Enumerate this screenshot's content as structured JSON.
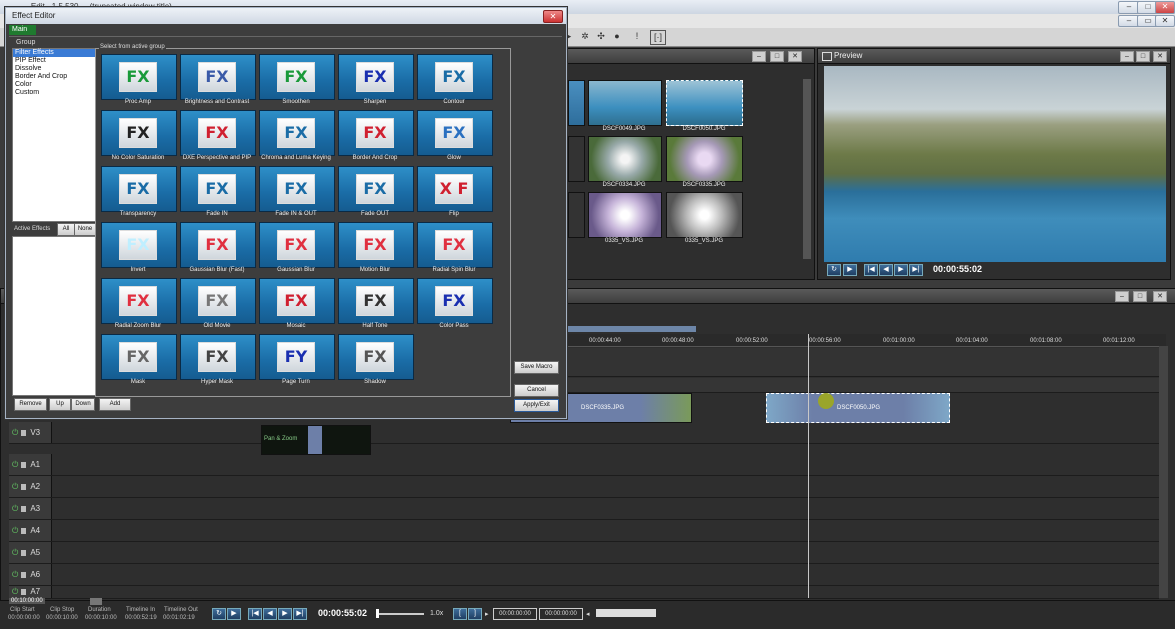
{
  "app": {
    "title": "... Edit - 1.5.530 ... (truncated window title)"
  },
  "effect_editor": {
    "title": "Effect Editor",
    "tab": "Main",
    "group_label": "Group",
    "groups": [
      "Filter Effects",
      "PIP Effect",
      "Dissolve",
      "Border And Crop",
      "Color",
      "Custom"
    ],
    "select_label": "Select from active group",
    "active_effects_label": "Active Effects",
    "all_label": "All",
    "none_label": "None",
    "effects": [
      {
        "label": "Proc Amp",
        "logo": "FX",
        "color": "#1a9a3a"
      },
      {
        "label": "Brightness and Contrast",
        "logo": "FX",
        "color": "#3a5aa8"
      },
      {
        "label": "Smoothen",
        "logo": "FX",
        "color": "#1a9a3a"
      },
      {
        "label": "Sharpen",
        "logo": "FX",
        "color": "#1a2fb0"
      },
      {
        "label": "Contour",
        "logo": "FX",
        "color": "#1a6ca6"
      },
      {
        "label": "No Color Saturation",
        "logo": "FX",
        "color": "#222222"
      },
      {
        "label": "DXE Perspective and PIP",
        "logo": "FX",
        "color": "#d02030"
      },
      {
        "label": "Chroma and Luma Keying",
        "logo": "FX",
        "color": "#1a6ca6"
      },
      {
        "label": "Border And Crop",
        "logo": "FX",
        "color": "#d02030"
      },
      {
        "label": "Glow",
        "logo": "FX",
        "color": "#2a70c0"
      },
      {
        "label": "Transparency",
        "logo": "FX",
        "color": "#1a6ca6"
      },
      {
        "label": "Fade IN",
        "logo": "FX",
        "color": "#1a6ca6"
      },
      {
        "label": "Fade IN & OUT",
        "logo": "FX",
        "color": "#1a6ca6"
      },
      {
        "label": "Fade OUT",
        "logo": "FX",
        "color": "#1a6ca6"
      },
      {
        "label": "Flip",
        "logo": "X F",
        "color": "#d02030"
      },
      {
        "label": "Invert",
        "logo": "FX",
        "color": "#bfefff"
      },
      {
        "label": "Gaussian Blur (Fast)",
        "logo": "FX",
        "color": "#e03040"
      },
      {
        "label": "Gaussian Blur",
        "logo": "FX",
        "color": "#e03040"
      },
      {
        "label": "Motion Blur",
        "logo": "FX",
        "color": "#e03040"
      },
      {
        "label": "Radial Spin Blur",
        "logo": "FX",
        "color": "#e03040"
      },
      {
        "label": "Radial Zoom Blur",
        "logo": "FX",
        "color": "#e03040"
      },
      {
        "label": "Old Movie",
        "logo": "FX",
        "color": "#777777"
      },
      {
        "label": "Mosaic",
        "logo": "FX",
        "color": "#d02030"
      },
      {
        "label": "Half Tone",
        "logo": "FX",
        "color": "#333333"
      },
      {
        "label": "Color Pass",
        "logo": "FX",
        "color": "#1a2fb0"
      },
      {
        "label": "Mask",
        "logo": "FX",
        "color": "#666666"
      },
      {
        "label": "Hyper Mask",
        "logo": "FX",
        "color": "#444444"
      },
      {
        "label": "Page Turn",
        "logo": "FY",
        "color": "#1a2fb0"
      },
      {
        "label": "Shadow",
        "logo": "FX",
        "color": "#555555"
      }
    ],
    "buttons": {
      "save_macro": "Save Macro",
      "cancel": "Cancel",
      "apply_exit": "Apply/Exit",
      "remove": "Remove",
      "up": "Up",
      "down": "Down",
      "add": "Add"
    }
  },
  "media_bin": {
    "thumbs": [
      {
        "caption": "DSCF0049.JPG",
        "kind": "sea"
      },
      {
        "caption": "DSCF0050.JPG",
        "kind": "sea"
      },
      {
        "caption": "DSCF0334.JPG",
        "kind": "flower"
      },
      {
        "caption": "DSCF0335.JPG",
        "kind": "flower"
      },
      {
        "caption": "0335_VS.JPG",
        "kind": "flower"
      },
      {
        "caption": "0335_VS.JPG",
        "kind": "flower"
      }
    ]
  },
  "preview": {
    "title": "Preview",
    "timecode": "00:00:55:02"
  },
  "timeline": {
    "ruler": [
      "00:00:44:00",
      "00:00:48:00",
      "00:00:52:00",
      "00:00:56:00",
      "00:01:00:00",
      "00:01:04:00",
      "00:01:08:00",
      "00:01:12:00"
    ],
    "tracks": [
      "V3",
      "A1",
      "A2",
      "A3",
      "A4",
      "A5",
      "A6",
      "A7"
    ],
    "clips": {
      "v2a": "DSCF0335.JPG",
      "v2b": "DSCF0050.JPG",
      "v3_text": "Pan & Zoom"
    }
  },
  "status": {
    "current_time": "00:10:00:00",
    "clip_start_label": "Clip Start",
    "clip_start": "00:00:00:00",
    "clip_stop_label": "Clip Stop",
    "clip_stop": "00:00:10:00",
    "duration_label": "Duration",
    "duration": "00:00:10:00",
    "timeline_in_label": "Timeline In",
    "timeline_in": "00:00:52:19",
    "timeline_out_label": "Timeline Out",
    "timeline_out": "00:01:02:19",
    "position": "00:00:55:02",
    "speed": "1.0x",
    "mark_in": "00:00:00:00",
    "mark_out": "00:00:00:00"
  }
}
